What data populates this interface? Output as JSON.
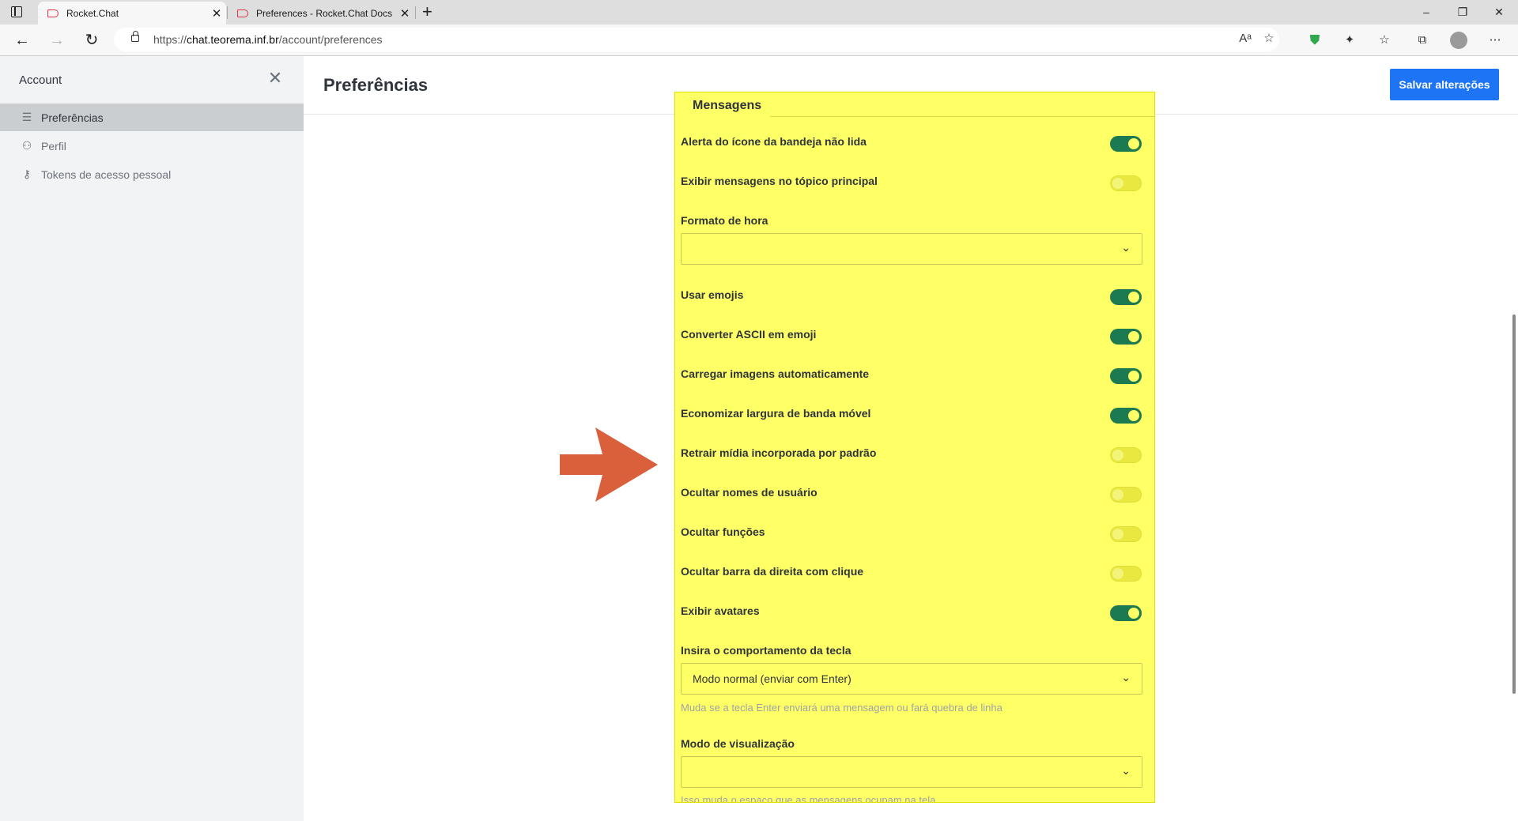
{
  "browser": {
    "tabs": [
      {
        "label": "Rocket.Chat",
        "active": true
      },
      {
        "label": "Preferences - Rocket.Chat Docs",
        "active": false
      }
    ],
    "url_prefix": "https://",
    "url_host": "chat.teorema.inf.br",
    "url_path": "/account/preferences"
  },
  "sidebar": {
    "title": "Account",
    "items": [
      {
        "label": "Preferências",
        "icon": "sliders-icon",
        "selected": true
      },
      {
        "label": "Perfil",
        "icon": "user-icon",
        "selected": false
      },
      {
        "label": "Tokens de acesso pessoal",
        "icon": "key-icon",
        "selected": false
      }
    ]
  },
  "header": {
    "title": "Preferências",
    "save_label": "Salvar alterações"
  },
  "section": {
    "title": "Mensagens",
    "settings": [
      {
        "label": "Alerta do ícone da bandeja não lida",
        "type": "toggle",
        "value": true
      },
      {
        "label": "Exibir mensagens no tópico principal",
        "type": "toggle",
        "value": false
      },
      {
        "label": "Formato de hora",
        "type": "select",
        "value": ""
      },
      {
        "label": "Usar emojis",
        "type": "toggle",
        "value": true
      },
      {
        "label": "Converter ASCII em emoji",
        "type": "toggle",
        "value": true
      },
      {
        "label": "Carregar imagens automaticamente",
        "type": "toggle",
        "value": true
      },
      {
        "label": "Economizar largura de banda móvel",
        "type": "toggle",
        "value": true
      },
      {
        "label": "Retrair mídia incorporada por padrão",
        "type": "toggle",
        "value": false
      },
      {
        "label": "Ocultar nomes de usuário",
        "type": "toggle",
        "value": false
      },
      {
        "label": "Ocultar funções",
        "type": "toggle",
        "value": false
      },
      {
        "label": "Ocultar barra da direita com clique",
        "type": "toggle",
        "value": false
      },
      {
        "label": "Exibir avatares",
        "type": "toggle",
        "value": true
      },
      {
        "label": "Insira o comportamento da tecla",
        "type": "select",
        "value": "Modo normal (enviar com Enter)",
        "hint": "Muda se a tecla Enter enviará uma mensagem ou fará quebra de linha"
      },
      {
        "label": "Modo de visualização",
        "type": "select",
        "value": "",
        "hint": "Isso muda o espaço que as mensagens ocupam na tela."
      }
    ]
  },
  "colors": {
    "highlight": "#ffff66",
    "toggle_on": "#1b7a4f",
    "primary_button": "#1d74f5",
    "annotation_arrow": "#d9603b"
  }
}
